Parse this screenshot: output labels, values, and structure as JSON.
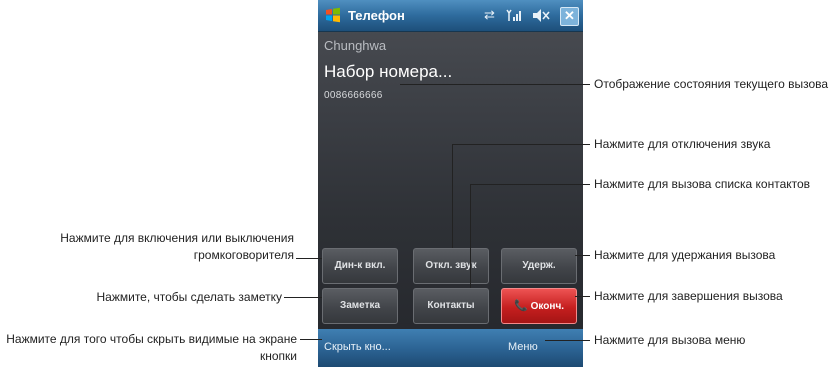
{
  "phone": {
    "title": "Телефон",
    "carrier": "Chunghwa",
    "call_status": "Набор номера...",
    "dialed_number": "0086666666",
    "buttons": {
      "speaker": "Дин-к вкл.",
      "mute": "Откл. звук",
      "hold": "Удерж.",
      "note": "Заметка",
      "contacts": "Контакты",
      "end": "Оконч."
    },
    "softkeys": {
      "left": "Скрыть кно...",
      "right": "Меню"
    },
    "colors": {
      "end_button": "#c51f1f",
      "titlebar": "#2e6b9d",
      "softbar": "#2b6292"
    }
  },
  "callouts": {
    "status": "Отображение состояния текущего вызова",
    "mute": "Нажмите для отключения звука",
    "contacts": "Нажмите для вызова списка контактов",
    "hold": "Нажмите для удержания вызова",
    "end": "Нажмите для завершения вызова",
    "menu": "Нажмите для вызова меню",
    "speaker_line1": "Нажмите для включения или выключения",
    "speaker_line2": "громкоговорителя",
    "note": "Нажмите, чтобы сделать заметку",
    "hide_line1": "Нажмите для того чтобы скрыть видимые на экране",
    "hide_line2": "кнопки"
  }
}
